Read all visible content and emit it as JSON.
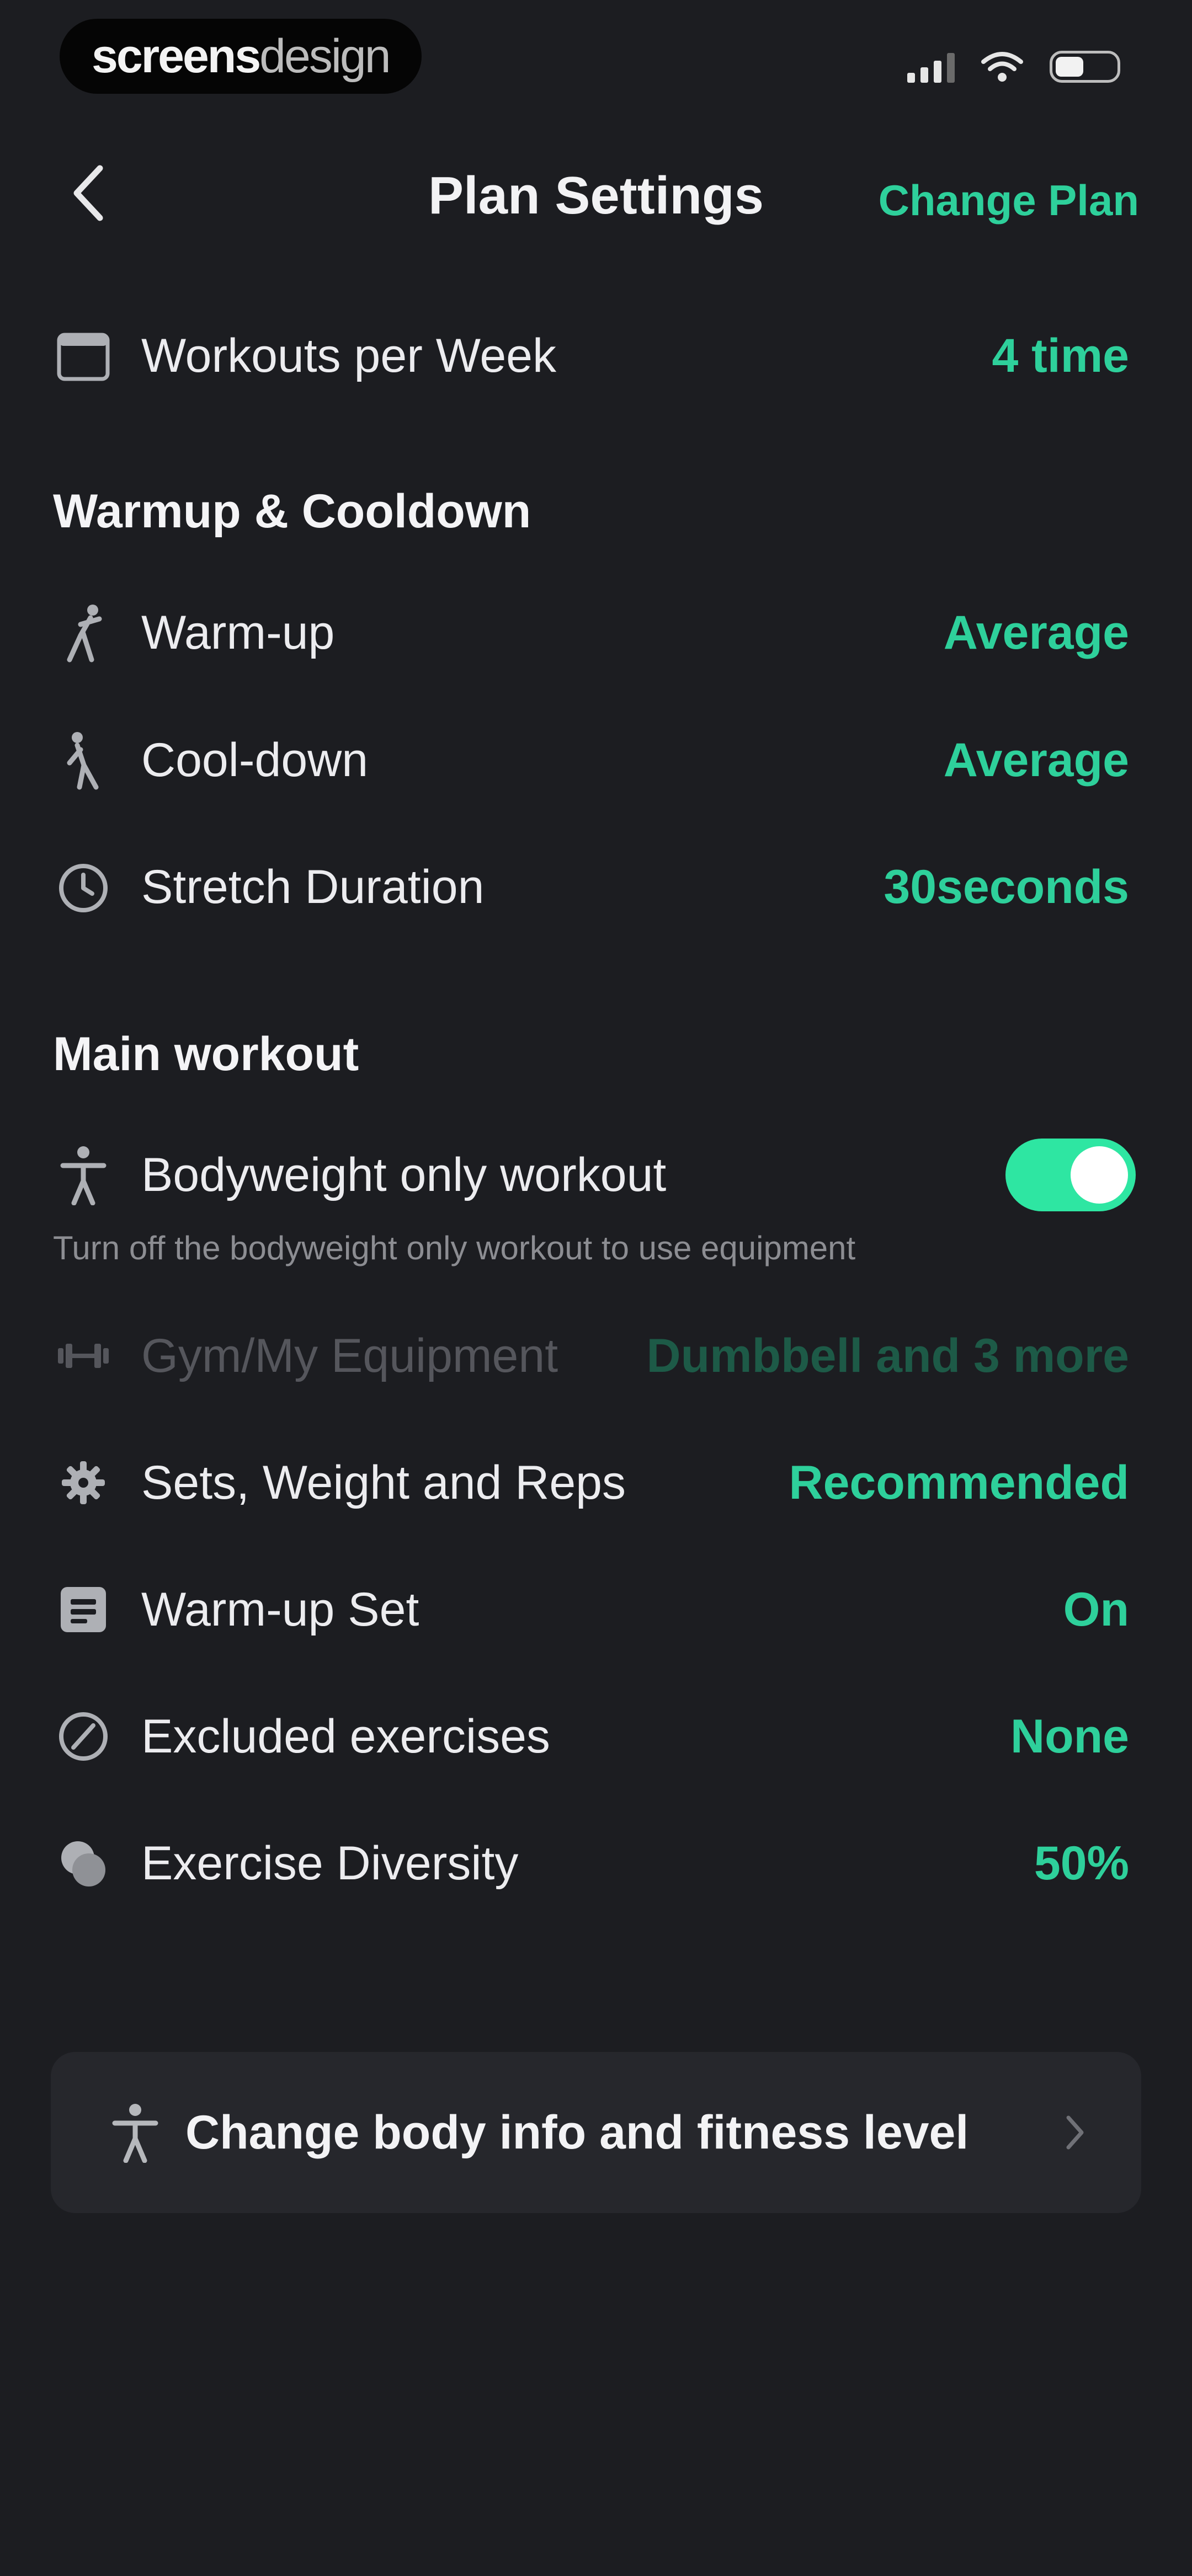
{
  "status_bar": {
    "brand_bold": "screens",
    "brand_light": "design",
    "battery_level": 0.42
  },
  "nav": {
    "title": "Plan Settings",
    "right_action": "Change Plan"
  },
  "frequency": {
    "label": "Workouts per Week",
    "value": "4 time",
    "icon": "calendar-icon"
  },
  "warmup_section": {
    "header": "Warmup & Cooldown",
    "items": [
      {
        "label": "Warm-up",
        "value": "Average",
        "icon": "warmup-icon"
      },
      {
        "label": "Cool-down",
        "value": "Average",
        "icon": "cooldown-icon"
      },
      {
        "label": "Stretch Duration",
        "value": "30seconds",
        "icon": "timer-icon"
      }
    ]
  },
  "main_section": {
    "header": "Main workout",
    "bodyweight": {
      "label": "Bodyweight only workout",
      "enabled": true,
      "helper": "Turn off the bodyweight only workout to use equipment",
      "icon": "person-icon"
    },
    "items": [
      {
        "label": "Gym/My Equipment",
        "value": "Dumbbell and 3 more",
        "disabled": true,
        "icon": "dumbbell-icon"
      },
      {
        "label": "Sets, Weight and Reps",
        "value": "Recommended",
        "icon": "gear-icon"
      },
      {
        "label": "Warm-up Set",
        "value": "On",
        "icon": "warmup-set-icon"
      },
      {
        "label": "Excluded exercises",
        "value": "None",
        "icon": "excluded-icon"
      },
      {
        "label": "Exercise Diversity",
        "value": "50%",
        "icon": "diversity-icon"
      }
    ]
  },
  "body_info": {
    "label": "Change body info and fitness level",
    "icon": "person-icon"
  },
  "colors": {
    "accent": "#2ed09b",
    "background": "#1c1d21",
    "card": "#26272c",
    "toggle_on": "#2ee6a2"
  }
}
